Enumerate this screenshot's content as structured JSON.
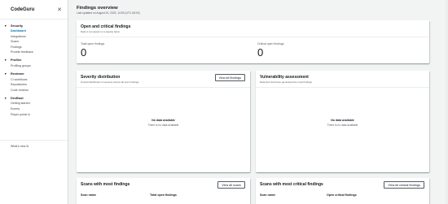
{
  "sidebar": {
    "title": "CodeGuru",
    "close_icon": "close-icon",
    "sections": [
      {
        "label": "Security",
        "items": [
          {
            "label": "Dashboard",
            "active": true
          },
          {
            "label": "Integrations"
          },
          {
            "label": "Scans"
          },
          {
            "label": "Findings"
          },
          {
            "label": "Provide feedback"
          }
        ]
      },
      {
        "label": "Profiler",
        "items": [
          {
            "label": "Profiling groups"
          }
        ]
      },
      {
        "label": "Reviewer",
        "items": [
          {
            "label": "CI workflows"
          },
          {
            "label": "Repositories"
          },
          {
            "label": "Code reviews"
          }
        ]
      },
      {
        "label": "DevBoot",
        "items": [
          {
            "label": "Getting started"
          },
          {
            "label": "Events"
          },
          {
            "label": "Player portal",
            "external": true
          }
        ]
      }
    ],
    "whats_new": "What's new"
  },
  "header": {
    "title": "Findings overview",
    "subtitle": "Last updated on August 24, 2023, 14:53 (UTC-08:00)"
  },
  "open_critical": {
    "title": "Open and critical findings",
    "description": "Data is computed on a weekly basis",
    "total_label": "Total open findings",
    "total_value": "0",
    "critical_label": "Critical open findings",
    "critical_value": "0"
  },
  "severity": {
    "title": "Severity distribution",
    "description": "Overall distribution of severity across all open findings",
    "button": "View all findings",
    "empty_title": "No data available",
    "empty_desc": "There is no data available"
  },
  "vulnerability": {
    "title": "Vulnerability assessment",
    "description": "Detectors that have generated the most findings",
    "empty_title": "No data available",
    "empty_desc": "There is no data available"
  },
  "scans_most": {
    "title": "Scans with most findings",
    "button": "View all scans",
    "col1": "Scan name",
    "col2": "Total open findings"
  },
  "scans_critical": {
    "title": "Scans with most critical findings",
    "button": "View all critical findings",
    "col1": "Scan name",
    "col2": "Open critical findings"
  }
}
